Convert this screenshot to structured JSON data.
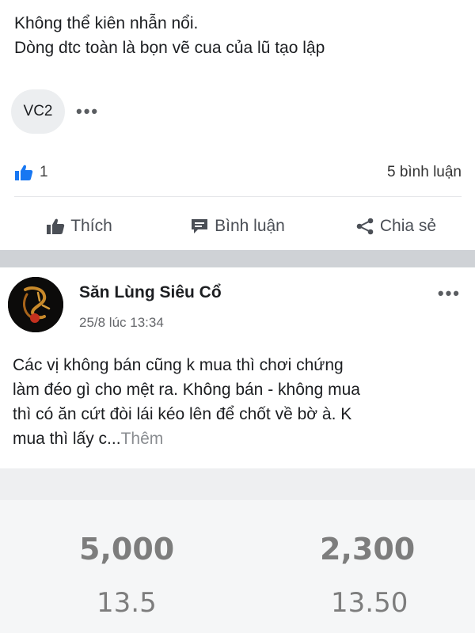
{
  "post": {
    "text_lines": [
      "Không thể kiên nhẫn nổi.",
      "Dòng dtc toàn là bọn vẽ cua của lũ tạo lập"
    ],
    "tag": "VC2",
    "more": "•••",
    "like_count": "1",
    "comment_count": "5 bình luận"
  },
  "actions": {
    "like": "Thích",
    "comment": "Bình luận",
    "share": "Chia sẻ"
  },
  "next_post": {
    "author": "Săn Lùng Siêu Cổ",
    "time": "25/8 lúc 13:34",
    "more": "•••",
    "body_lines": [
      "Các vị không bán cũng k mua thì chơi chứng",
      "làm đéo gì cho mệt ra. Không bán - không mua",
      "thì có ăn cứt đòi lái kéo lên để chốt về bờ à. K"
    ],
    "body_last": "mua thì lấy c...",
    "see_more": "Thêm"
  },
  "preview": {
    "left_big": "5,000",
    "right_big": "2,300",
    "left_small": "13.5",
    "right_small": "13.50"
  },
  "colors": {
    "like_blue": "#1877f2",
    "divider": "#cfd2d6"
  },
  "icons": [
    "thumbs-up-icon",
    "comment-icon",
    "share-icon",
    "more-icon"
  ]
}
